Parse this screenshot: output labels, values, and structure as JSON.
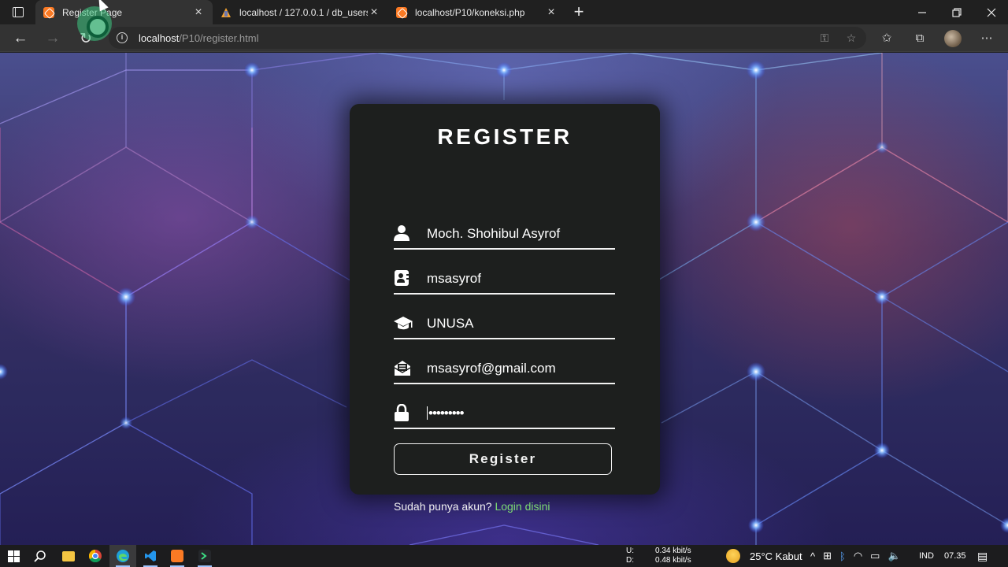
{
  "tabs": [
    {
      "title": "Register Page",
      "active": true,
      "favicon": "xampp-icon"
    },
    {
      "title": "localhost / 127.0.0.1 / db_users /",
      "active": false,
      "favicon": "phpmyadmin-icon"
    },
    {
      "title": "localhost/P10/koneksi.php",
      "active": false,
      "favicon": "xampp-icon"
    }
  ],
  "address": {
    "host": "localhost",
    "path": "/P10/register.html"
  },
  "form": {
    "title": "REGISTER",
    "fields": [
      {
        "icon": "user-icon",
        "value": "Moch. Shohibul Asyrof"
      },
      {
        "icon": "id-card-icon",
        "value": "msasyrof"
      },
      {
        "icon": "graduation-cap-icon",
        "value": "UNUSA"
      },
      {
        "icon": "mail-envelope-icon",
        "value": "msasyrof@gmail.com"
      },
      {
        "icon": "lock-icon",
        "value": "•••••••••"
      }
    ],
    "submit_label": "Register",
    "footer_text": "Sudah punya akun? ",
    "footer_link": "Login disini"
  },
  "taskbar": {
    "net_up_label": "U:",
    "net_up": "0.34 kbit/s",
    "net_down_label": "D:",
    "net_down": "0.48 kbit/s",
    "weather": "25°C  Kabut",
    "language": "IND",
    "clock": "07.35"
  },
  "colors": {
    "link": "#7ddc72",
    "card": "#1d1f1e",
    "xampp": "#fb7a24"
  }
}
